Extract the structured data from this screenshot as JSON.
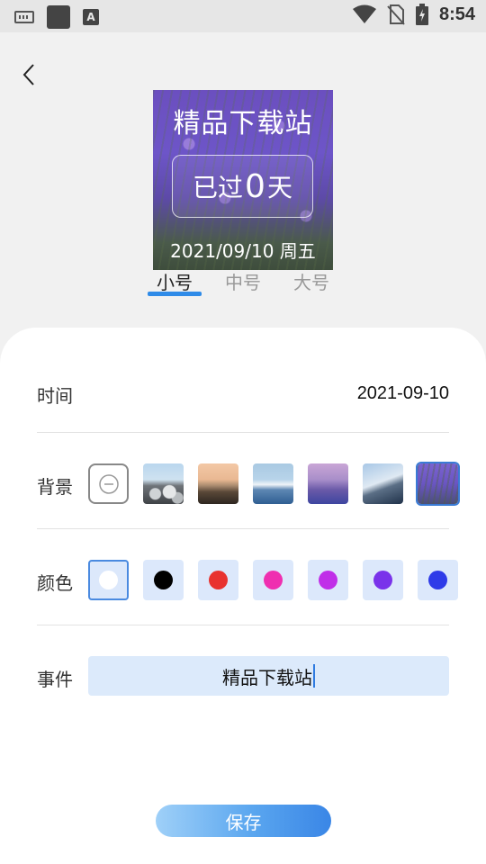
{
  "status_bar": {
    "time": "8:54",
    "icons": [
      "keyboard-icon",
      "app-square-icon",
      "font-a-icon",
      "wifi-icon",
      "no-sim-icon",
      "battery-charging-icon"
    ]
  },
  "header": {
    "back_icon": "chevron-left-icon"
  },
  "preview": {
    "title": "精品下载站",
    "counter_prefix": "已过",
    "counter_value": "0",
    "counter_suffix": "天",
    "date": "2021/09/10 周五"
  },
  "size_tabs": [
    {
      "label": "小号",
      "active": true
    },
    {
      "label": "中号",
      "active": false
    },
    {
      "label": "大号",
      "active": false
    }
  ],
  "form": {
    "time_label": "时间",
    "time_value": "2021-09-10",
    "background_label": "背景",
    "backgrounds": [
      "none",
      "stones-beach",
      "sunset-pier",
      "ice-sea",
      "purple-mountain",
      "snow-mountain",
      "lavender-field"
    ],
    "background_selected": "lavender-field",
    "color_label": "颜色",
    "colors": [
      "#ffffff",
      "#000000",
      "#e8322f",
      "#ef2fb0",
      "#c02fe8",
      "#7a33ea",
      "#2f3be8"
    ],
    "color_selected": "#ffffff",
    "event_label": "事件",
    "event_value": "精品下载站"
  },
  "save_label": "保存"
}
